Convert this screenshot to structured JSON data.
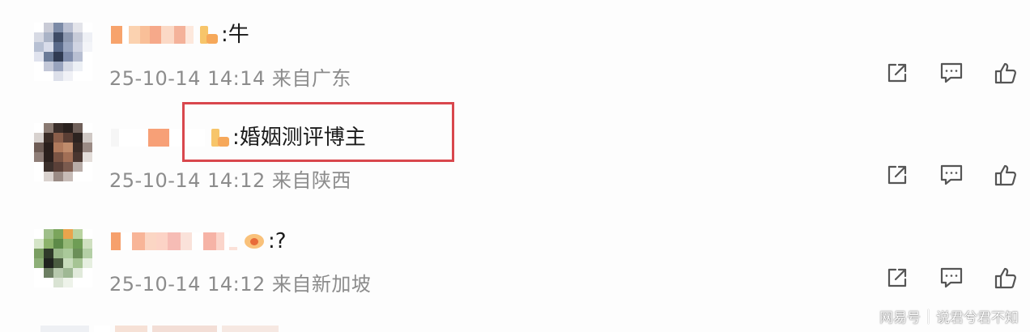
{
  "comments": [
    {
      "text": ":牛",
      "meta": "25-10-14 14:14 来自广东"
    },
    {
      "text": ":婚姻测评博主",
      "meta": "25-10-14 14:12 来自陕西"
    },
    {
      "text": ":?",
      "meta": "25-10-14 14:12 来自新加坡"
    }
  ],
  "icons": {
    "share": "share-icon",
    "comment": "comment-icon",
    "like": "like-icon"
  },
  "footer": {
    "platform": "网易号",
    "author": "说君兮君不知"
  },
  "colors": {
    "highlight": "#d9474d",
    "meta_text": "#8c8c8c",
    "icon": "#555555"
  }
}
